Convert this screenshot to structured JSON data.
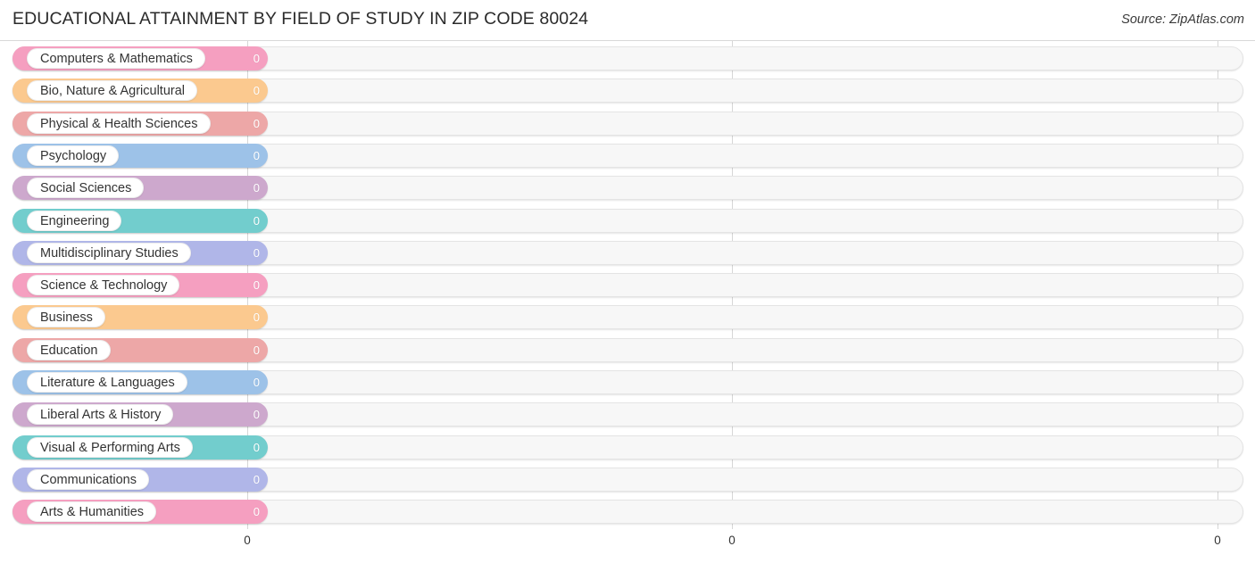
{
  "header": {
    "title": "EDUCATIONAL ATTAINMENT BY FIELD OF STUDY IN ZIP CODE 80024",
    "source": "Source: ZipAtlas.com"
  },
  "chart_data": {
    "type": "bar",
    "orientation": "horizontal",
    "title": "EDUCATIONAL ATTAINMENT BY FIELD OF STUDY IN ZIP CODE 80024",
    "xlabel": "",
    "ylabel": "",
    "xlim": [
      0,
      0
    ],
    "grid": true,
    "legend": false,
    "axis_ticks": [
      "0",
      "0",
      "0"
    ],
    "categories": [
      "Computers & Mathematics",
      "Bio, Nature & Agricultural",
      "Physical & Health Sciences",
      "Psychology",
      "Social Sciences",
      "Engineering",
      "Multidisciplinary Studies",
      "Science & Technology",
      "Business",
      "Education",
      "Literature & Languages",
      "Liberal Arts & History",
      "Visual & Performing Arts",
      "Communications",
      "Arts & Humanities"
    ],
    "values": [
      0,
      0,
      0,
      0,
      0,
      0,
      0,
      0,
      0,
      0,
      0,
      0,
      0,
      0,
      0
    ],
    "value_labels": [
      "0",
      "0",
      "0",
      "0",
      "0",
      "0",
      "0",
      "0",
      "0",
      "0",
      "0",
      "0",
      "0",
      "0",
      "0"
    ],
    "colors": [
      "#f59fc0",
      "#fbc98f",
      "#eda7a7",
      "#9dc2e8",
      "#cda8cd",
      "#72cdcd",
      "#b0b6e8",
      "#f59fc0",
      "#fbc98f",
      "#eda7a7",
      "#9dc2e8",
      "#cda8cd",
      "#72cdcd",
      "#b0b6e8",
      "#f59fc0"
    ]
  }
}
